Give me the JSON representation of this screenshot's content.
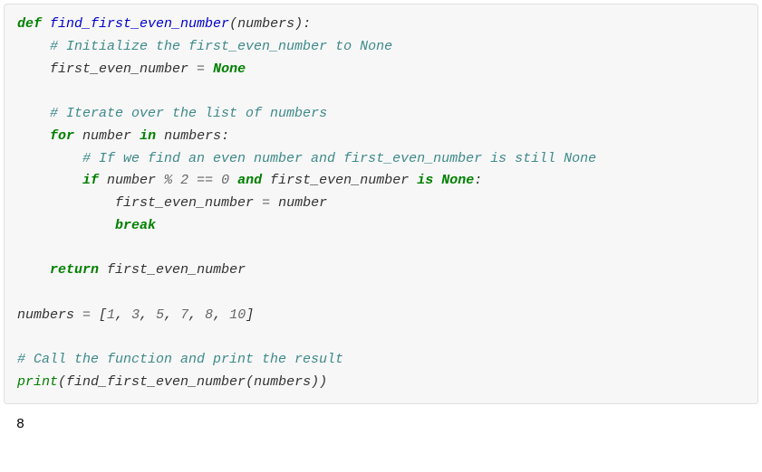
{
  "code": {
    "l1_def": "def",
    "l1_fn": "find_first_even_number",
    "l1_open": "(",
    "l1_param": "numbers",
    "l1_close": "):",
    "l2_cm": "# Initialize the first_even_number to None",
    "l3_var": "first_even_number",
    "l3_eq": " = ",
    "l3_none": "None",
    "l5_cm": "# Iterate over the list of numbers",
    "l6_for": "for",
    "l6_var": "number",
    "l6_in": "in",
    "l6_iter": "numbers",
    "l6_colon": ":",
    "l7_cm": "# If we find an even number and first_even_number is still None",
    "l8_if": "if",
    "l8_var1": "number",
    "l8_mod": " % ",
    "l8_two": "2",
    "l8_eqeq": " == ",
    "l8_zero": "0",
    "l8_and": "and",
    "l8_var2": "first_even_number",
    "l8_is": "is",
    "l8_none": "None",
    "l8_colon": ":",
    "l9_var": "first_even_number",
    "l9_eq": " = ",
    "l9_val": "number",
    "l10_break": "break",
    "l12_return": "return",
    "l12_var": "first_even_number",
    "l14_var": "numbers",
    "l14_eq": " = ",
    "l14_open": "[",
    "l14_n1": "1",
    "l14_c1": ", ",
    "l14_n2": "3",
    "l14_c2": ", ",
    "l14_n3": "5",
    "l14_c3": ", ",
    "l14_n4": "7",
    "l14_c4": ", ",
    "l14_n5": "8",
    "l14_c5": ", ",
    "l14_n6": "10",
    "l14_close": "]",
    "l16_cm": "# Call the function and print the result",
    "l17_print": "print",
    "l17_open": "(",
    "l17_fn": "find_first_even_number",
    "l17_open2": "(",
    "l17_arg": "numbers",
    "l17_close": "))"
  },
  "output": "8"
}
